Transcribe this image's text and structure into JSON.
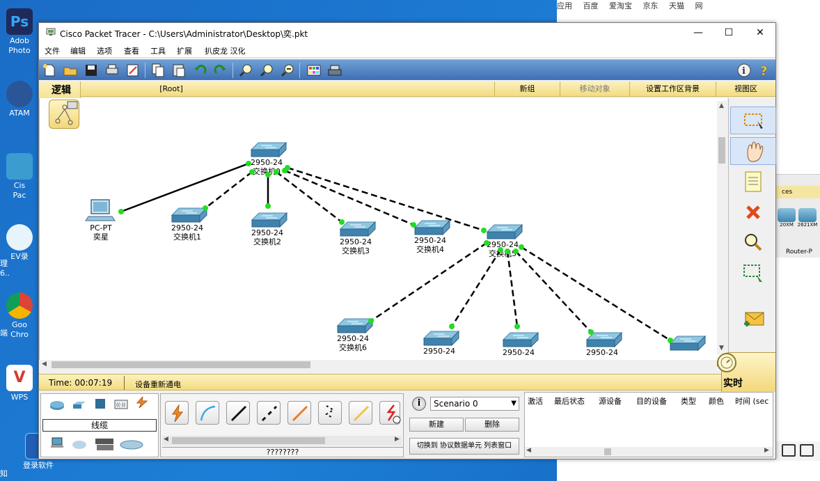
{
  "desktop": {
    "icons": [
      {
        "label": "Adob",
        "label2": "Photo",
        "color": "#1e2a5a"
      },
      {
        "label": "ATAM",
        "label2": "",
        "color": "#5b8bd1"
      },
      {
        "label": "Cis",
        "label2": "Pac",
        "color": "#3a9ccf"
      },
      {
        "label": "EV录",
        "label2": "",
        "color": "#5fb8e8"
      },
      {
        "label": "Goo",
        "label2": "Chro",
        "color": "#db4437"
      },
      {
        "label": "WPS",
        "label2": "",
        "color": "#d43a2f"
      },
      {
        "label": "登录软件",
        "label2": "",
        "color": "#1f5fb4"
      }
    ],
    "left_fragments": [
      "理",
      "6..",
      "端",
      "知"
    ]
  },
  "background_browser": {
    "bookmarks": [
      "应用",
      "百度",
      "爱淘宝",
      "京东",
      "天猫",
      "网"
    ],
    "device_panel_header": "ces",
    "device_panel_items": [
      "20XM",
      "2621XM"
    ],
    "device_panel_footer": "Router-P"
  },
  "window": {
    "title": "Cisco Packet Tracer - C:\\Users\\Administrator\\Desktop\\奕.pkt",
    "minimize": "—",
    "maximize": "☐",
    "close": "✕"
  },
  "menu": {
    "items": [
      "文件",
      "编辑",
      "选项",
      "查看",
      "工具",
      "扩展",
      "扒皮龙 汉化"
    ]
  },
  "logic_bar": {
    "tab": "逻辑",
    "root": "[Root]",
    "new_cluster": "新组",
    "move_object": "移动对象",
    "set_background": "设置工作区背景",
    "viewport": "视图区"
  },
  "devices": [
    {
      "model": "PC-PT",
      "name": "奕星",
      "type": "pc"
    },
    {
      "model": "2950-24",
      "name": "交换机0",
      "type": "switch"
    },
    {
      "model": "2950-24",
      "name": "交换机1",
      "type": "switch"
    },
    {
      "model": "2950-24",
      "name": "交换机2",
      "type": "switch"
    },
    {
      "model": "2950-24",
      "name": "交换机3",
      "type": "switch"
    },
    {
      "model": "2950-24",
      "name": "交换机4",
      "type": "switch"
    },
    {
      "model": "2950-24",
      "name": "交换机5",
      "type": "switch"
    },
    {
      "model": "2950-24",
      "name": "交换机6",
      "type": "switch"
    },
    {
      "model": "2950-24",
      "name": "",
      "type": "switch"
    },
    {
      "model": "2950-24",
      "name": "",
      "type": "switch"
    },
    {
      "model": "2950-24",
      "name": "",
      "type": "switch"
    },
    {
      "model": "",
      "name": "",
      "type": "switch"
    }
  ],
  "status": {
    "time": "Time: 00:07:19",
    "message": "设备重新通电",
    "realtime": "实时"
  },
  "bottom": {
    "device_category": "线缆",
    "cable_label": "????????",
    "scenario": "Scenario 0",
    "new_btn": "新建",
    "delete_btn": "删除",
    "toggle_btn": "切换到 协议数据单元 列表窗口",
    "event_headers": [
      "激活",
      "最后状态",
      "源设备",
      "目的设备",
      "类型",
      "颜色",
      "时间 (sec"
    ]
  },
  "colors": {
    "toolbar": "#4f80c2",
    "logic_bar": "#f6e49a",
    "link": "#000000",
    "port_led": "#22dd22",
    "switch": "#5a9ec4"
  }
}
